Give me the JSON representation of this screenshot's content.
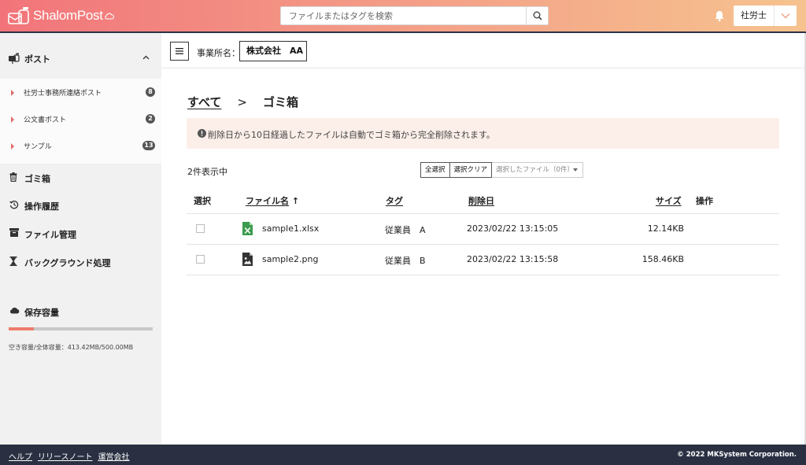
{
  "header": {
    "logo_text": "ShalomPost",
    "search": {
      "placeholder": "ファイルまたはタグを検索",
      "value": ""
    },
    "user": "社労士",
    "colors": {
      "gradient_start": "#f2747a",
      "gradient_end": "#f6c38f",
      "bar": "#2b3245"
    }
  },
  "sidebar": {
    "post": {
      "label": "ポスト",
      "icon": "mailbox-icon",
      "expanded": true
    },
    "post_items": [
      {
        "label": "社労士事務所連絡ポスト",
        "count": "8"
      },
      {
        "label": "公文書ポスト",
        "count": "2"
      },
      {
        "label": "サンプル",
        "count": "13"
      }
    ],
    "nav": [
      {
        "label": "ゴミ箱",
        "icon": "trash-icon"
      },
      {
        "label": "操作履歴",
        "icon": "history-icon"
      },
      {
        "label": "ファイル管理",
        "icon": "archive-icon"
      },
      {
        "label": "バックグラウンド処理",
        "icon": "hourglass-icon"
      }
    ],
    "storage": {
      "label": "保存容量",
      "icon": "cloud-icon",
      "text": "空き容量/全体容量：413.42MB/500.00MB",
      "used_fraction": 0.173
    }
  },
  "toolbar": {
    "office_label": "事業所名：",
    "office_value": "株式会社　AA"
  },
  "main": {
    "breadcrumb": {
      "root": "すべて",
      "separator": ">",
      "current": "ゴミ箱"
    },
    "notice": "削除日から10日経過したファイルは自動でゴミ箱から完全削除されます。",
    "count_text": "2件表示中",
    "select_all": "全選択",
    "select_clear": "選択クリア",
    "selected_files": "選択したファイル（0件）",
    "columns": {
      "select": "選択",
      "filename": "ファイル名",
      "sort_arrow": "↑",
      "tag": "タグ",
      "deleted": "削除日",
      "size": "サイズ",
      "actions": "操作"
    },
    "rows": [
      {
        "name": "sample1.xlsx",
        "icon": "excel-file-icon",
        "tag": "従業員　A",
        "deleted": "2023/02/22 13:15:05",
        "size": "12.14KB"
      },
      {
        "name": "sample2.png",
        "icon": "image-file-icon",
        "tag": "従業員　B",
        "deleted": "2023/02/22 13:15:58",
        "size": "158.46KB"
      }
    ]
  },
  "footer": {
    "links": [
      "ヘルプ",
      "リリースノート",
      "運営会社"
    ],
    "copyright": "© 2022 MKSystem Corporation."
  }
}
